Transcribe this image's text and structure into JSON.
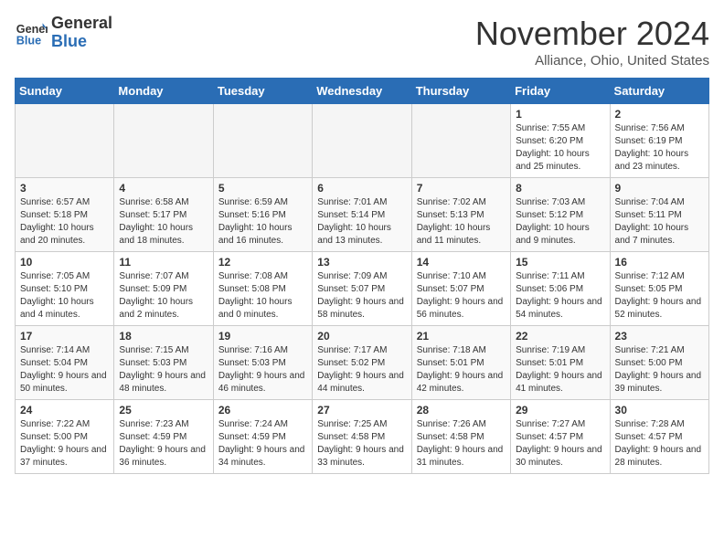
{
  "header": {
    "logo_general": "General",
    "logo_blue": "Blue",
    "month_title": "November 2024",
    "location": "Alliance, Ohio, United States"
  },
  "weekdays": [
    "Sunday",
    "Monday",
    "Tuesday",
    "Wednesday",
    "Thursday",
    "Friday",
    "Saturday"
  ],
  "weeks": [
    [
      {
        "day": "",
        "info": ""
      },
      {
        "day": "",
        "info": ""
      },
      {
        "day": "",
        "info": ""
      },
      {
        "day": "",
        "info": ""
      },
      {
        "day": "",
        "info": ""
      },
      {
        "day": "1",
        "info": "Sunrise: 7:55 AM\nSunset: 6:20 PM\nDaylight: 10 hours and 25 minutes."
      },
      {
        "day": "2",
        "info": "Sunrise: 7:56 AM\nSunset: 6:19 PM\nDaylight: 10 hours and 23 minutes."
      }
    ],
    [
      {
        "day": "3",
        "info": "Sunrise: 6:57 AM\nSunset: 5:18 PM\nDaylight: 10 hours and 20 minutes."
      },
      {
        "day": "4",
        "info": "Sunrise: 6:58 AM\nSunset: 5:17 PM\nDaylight: 10 hours and 18 minutes."
      },
      {
        "day": "5",
        "info": "Sunrise: 6:59 AM\nSunset: 5:16 PM\nDaylight: 10 hours and 16 minutes."
      },
      {
        "day": "6",
        "info": "Sunrise: 7:01 AM\nSunset: 5:14 PM\nDaylight: 10 hours and 13 minutes."
      },
      {
        "day": "7",
        "info": "Sunrise: 7:02 AM\nSunset: 5:13 PM\nDaylight: 10 hours and 11 minutes."
      },
      {
        "day": "8",
        "info": "Sunrise: 7:03 AM\nSunset: 5:12 PM\nDaylight: 10 hours and 9 minutes."
      },
      {
        "day": "9",
        "info": "Sunrise: 7:04 AM\nSunset: 5:11 PM\nDaylight: 10 hours and 7 minutes."
      }
    ],
    [
      {
        "day": "10",
        "info": "Sunrise: 7:05 AM\nSunset: 5:10 PM\nDaylight: 10 hours and 4 minutes."
      },
      {
        "day": "11",
        "info": "Sunrise: 7:07 AM\nSunset: 5:09 PM\nDaylight: 10 hours and 2 minutes."
      },
      {
        "day": "12",
        "info": "Sunrise: 7:08 AM\nSunset: 5:08 PM\nDaylight: 10 hours and 0 minutes."
      },
      {
        "day": "13",
        "info": "Sunrise: 7:09 AM\nSunset: 5:07 PM\nDaylight: 9 hours and 58 minutes."
      },
      {
        "day": "14",
        "info": "Sunrise: 7:10 AM\nSunset: 5:07 PM\nDaylight: 9 hours and 56 minutes."
      },
      {
        "day": "15",
        "info": "Sunrise: 7:11 AM\nSunset: 5:06 PM\nDaylight: 9 hours and 54 minutes."
      },
      {
        "day": "16",
        "info": "Sunrise: 7:12 AM\nSunset: 5:05 PM\nDaylight: 9 hours and 52 minutes."
      }
    ],
    [
      {
        "day": "17",
        "info": "Sunrise: 7:14 AM\nSunset: 5:04 PM\nDaylight: 9 hours and 50 minutes."
      },
      {
        "day": "18",
        "info": "Sunrise: 7:15 AM\nSunset: 5:03 PM\nDaylight: 9 hours and 48 minutes."
      },
      {
        "day": "19",
        "info": "Sunrise: 7:16 AM\nSunset: 5:03 PM\nDaylight: 9 hours and 46 minutes."
      },
      {
        "day": "20",
        "info": "Sunrise: 7:17 AM\nSunset: 5:02 PM\nDaylight: 9 hours and 44 minutes."
      },
      {
        "day": "21",
        "info": "Sunrise: 7:18 AM\nSunset: 5:01 PM\nDaylight: 9 hours and 42 minutes."
      },
      {
        "day": "22",
        "info": "Sunrise: 7:19 AM\nSunset: 5:01 PM\nDaylight: 9 hours and 41 minutes."
      },
      {
        "day": "23",
        "info": "Sunrise: 7:21 AM\nSunset: 5:00 PM\nDaylight: 9 hours and 39 minutes."
      }
    ],
    [
      {
        "day": "24",
        "info": "Sunrise: 7:22 AM\nSunset: 5:00 PM\nDaylight: 9 hours and 37 minutes."
      },
      {
        "day": "25",
        "info": "Sunrise: 7:23 AM\nSunset: 4:59 PM\nDaylight: 9 hours and 36 minutes."
      },
      {
        "day": "26",
        "info": "Sunrise: 7:24 AM\nSunset: 4:59 PM\nDaylight: 9 hours and 34 minutes."
      },
      {
        "day": "27",
        "info": "Sunrise: 7:25 AM\nSunset: 4:58 PM\nDaylight: 9 hours and 33 minutes."
      },
      {
        "day": "28",
        "info": "Sunrise: 7:26 AM\nSunset: 4:58 PM\nDaylight: 9 hours and 31 minutes."
      },
      {
        "day": "29",
        "info": "Sunrise: 7:27 AM\nSunset: 4:57 PM\nDaylight: 9 hours and 30 minutes."
      },
      {
        "day": "30",
        "info": "Sunrise: 7:28 AM\nSunset: 4:57 PM\nDaylight: 9 hours and 28 minutes."
      }
    ]
  ]
}
